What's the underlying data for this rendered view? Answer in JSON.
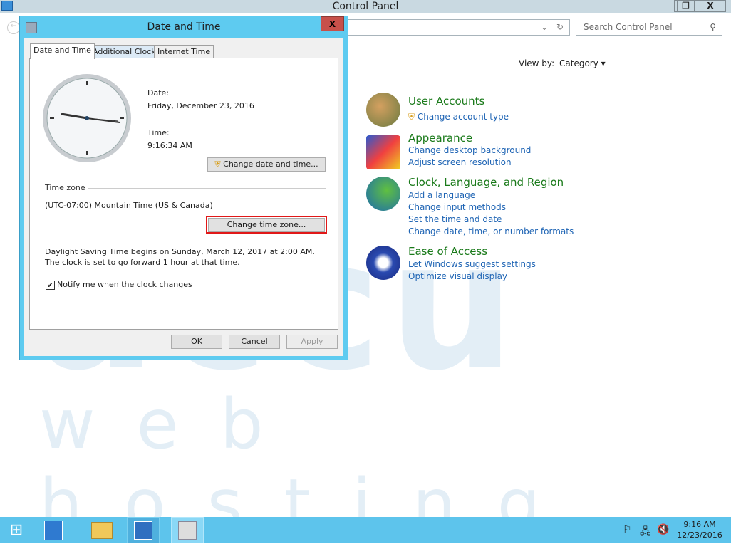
{
  "control_panel": {
    "title": "Control Panel",
    "search_placeholder": "Search Control Panel",
    "view_by_label": "View by:",
    "view_by_value": "Category",
    "categories": [
      {
        "title": "User Accounts",
        "links": [
          "Change account type"
        ]
      },
      {
        "title": "Appearance",
        "links": [
          "Change desktop background",
          "Adjust screen resolution"
        ]
      },
      {
        "title": "Clock, Language, and Region",
        "links": [
          "Add a language",
          "Change input methods",
          "Set the time and date",
          "Change date, time, or number formats"
        ]
      },
      {
        "title": "Ease of Access",
        "links": [
          "Let Windows suggest settings",
          "Optimize visual display"
        ]
      }
    ]
  },
  "dialog": {
    "title": "Date and Time",
    "tabs": [
      "Date and Time",
      "Additional Clocks",
      "Internet Time"
    ],
    "date_label": "Date:",
    "date_value": "Friday, December 23, 2016",
    "time_label": "Time:",
    "time_value": "9:16:34 AM",
    "change_datetime_button": "Change date and time...",
    "timezone_heading": "Time zone",
    "timezone_value": "(UTC-07:00) Mountain Time (US & Canada)",
    "change_timezone_button": "Change time zone...",
    "dst_text": "Daylight Saving Time begins on Sunday, March 12, 2017 at 2:00 AM. The clock is set to go forward 1 hour at that time.",
    "notify_label": "Notify me when the clock changes",
    "notify_checked": true,
    "ok": "OK",
    "cancel": "Cancel",
    "apply": "Apply"
  },
  "highlight_color": "#e01818",
  "watermark": {
    "line1": "accu",
    "line2": "web hosting"
  },
  "taskbar": {
    "time": "9:16 AM",
    "date": "12/23/2016"
  }
}
